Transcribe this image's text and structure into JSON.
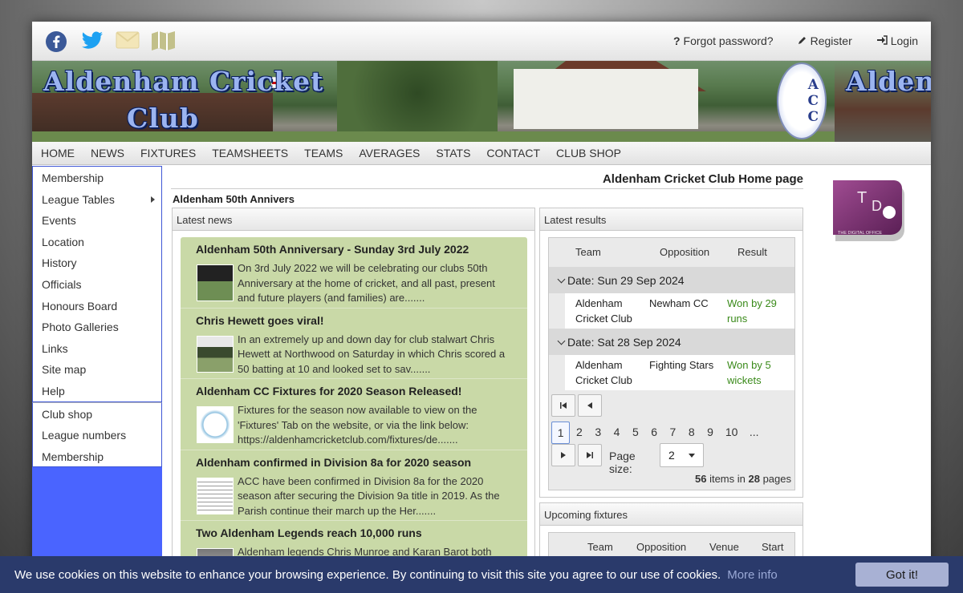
{
  "header": {
    "social_icons": [
      "facebook-icon",
      "twitter-icon",
      "email-icon",
      "map-icon"
    ],
    "forgot_password": "Forgot password?",
    "register": "Register",
    "login": "Login"
  },
  "banner": {
    "title_line1": "Aldenham Cricket",
    "title_line2": "Club",
    "crest_letters": [
      "A",
      "C",
      "C"
    ]
  },
  "nav": {
    "items": [
      "HOME",
      "NEWS",
      "FIXTURES",
      "TEAMSHEETS",
      "TEAMS",
      "AVERAGES",
      "STATS",
      "CONTACT",
      "CLUB SHOP"
    ]
  },
  "sidebar": {
    "items": [
      "Membership",
      "League Tables",
      "Events",
      "Location",
      "History",
      "Officials",
      "Honours Board",
      "Photo Galleries",
      "Links",
      "Site map",
      "Help"
    ],
    "items2": [
      "Club shop",
      "League numbers",
      "Membership"
    ]
  },
  "main": {
    "page_title": "Aldenham Cricket Club Home page",
    "subheading": "Aldenham 50th Annivers"
  },
  "news": {
    "header": "Latest news",
    "items": [
      {
        "title": "Aldenham 50th Anniversary - Sunday 3rd July 2022",
        "excerpt": "On 3rd July 2022 we will be celebrating our clubs 50th Anniversary at the home of cricket, and all past, present and future players (and families) are......."
      },
      {
        "title": "Chris Hewett goes viral!",
        "excerpt": "In an extremely up and down day for club stalwart Chris Hewett at Northwood on Saturday in which Chris scored a 50 batting at 10 and looked set to sav......."
      },
      {
        "title": "Aldenham CC Fixtures for 2020 Season Released!",
        "excerpt": "Fixtures for the season now available to view on the 'Fixtures' Tab on the website, or via the link below: https://aldenhamcricketclub.com/fixtures/de......."
      },
      {
        "title": "Aldenham confirmed in Division 8a for 2020 season",
        "excerpt": "ACC have been confirmed in Division 8a for the 2020 season after securing the Division 9a title in 2019. As the Parish continue their march up the Her......."
      },
      {
        "title": "Two Aldenham Legends reach 10,000 runs",
        "excerpt": "Aldenham legends Chris Munroe and Karan Barot both"
      }
    ]
  },
  "results": {
    "header": "Latest results",
    "columns": [
      "Team",
      "Opposition",
      "Result"
    ],
    "groups": [
      {
        "date": "Date: Sun 29 Sep 2024",
        "team": "Aldenham Cricket Club",
        "opposition": "Newham CC",
        "result": "Won by 29 runs"
      },
      {
        "date": "Date: Sat 28 Sep 2024",
        "team": "Aldenham Cricket Club",
        "opposition": "Fighting Stars",
        "result": "Won by 5 wickets"
      }
    ],
    "pages": [
      "1",
      "2",
      "3",
      "4",
      "5",
      "6",
      "7",
      "8",
      "9",
      "10",
      "..."
    ],
    "page_size_label": "Page size:",
    "page_size": "2",
    "items_count": "56",
    "items_text": "items in",
    "pages_count": "28",
    "pages_text": "pages"
  },
  "upcoming": {
    "header": "Upcoming fixtures",
    "columns": [
      "Team",
      "Opposition",
      "Venue",
      "Start"
    ]
  },
  "tdo_logo": {
    "letters": "TDO",
    "caption": "THE DIGITAL OFFICE"
  },
  "cookie": {
    "message": "We use cookies on this website to enhance your browsing experience. By continuing to visit this site you agree to our use of cookies.",
    "more_info": "More info",
    "button": "Got it!"
  }
}
